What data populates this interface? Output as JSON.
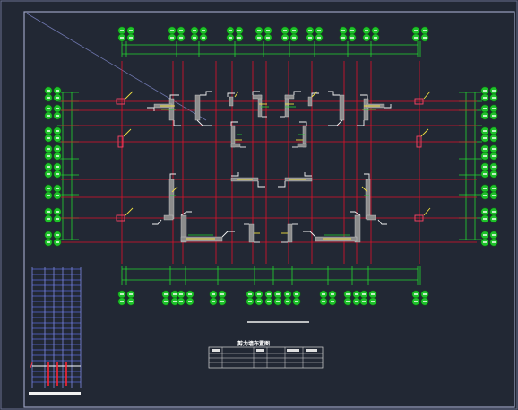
{
  "drawing": {
    "colors": {
      "background": "#222834",
      "frame": "#9aa0c0",
      "axis_red": "#e0102a",
      "dim_green": "#22d630",
      "bubble_green": "#1ec22a",
      "wall_gray": "#8c8c8c",
      "edge_white": "#f2f2f2",
      "yellow": "#f0e040"
    },
    "title_block": {
      "heading": "剪力墙布置图"
    }
  }
}
